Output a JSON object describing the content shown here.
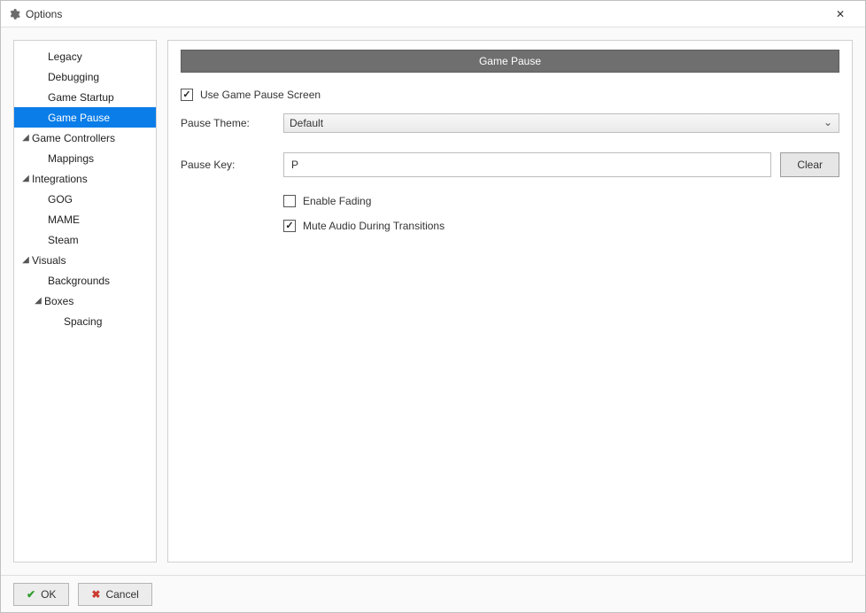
{
  "window": {
    "title": "Options"
  },
  "sidebar": {
    "items": [
      {
        "label": "Legacy",
        "depth": 1,
        "expandable": false
      },
      {
        "label": "Debugging",
        "depth": 1,
        "expandable": false
      },
      {
        "label": "Game Startup",
        "depth": 1,
        "expandable": false
      },
      {
        "label": "Game Pause",
        "depth": 1,
        "expandable": false,
        "selected": true
      },
      {
        "label": "Game Controllers",
        "depth": 0,
        "expandable": true,
        "expanded": true
      },
      {
        "label": "Mappings",
        "depth": 1,
        "expandable": false
      },
      {
        "label": "Integrations",
        "depth": 0,
        "expandable": true,
        "expanded": true
      },
      {
        "label": "GOG",
        "depth": 1,
        "expandable": false
      },
      {
        "label": "MAME",
        "depth": 1,
        "expandable": false
      },
      {
        "label": "Steam",
        "depth": 1,
        "expandable": false
      },
      {
        "label": "Visuals",
        "depth": 0,
        "expandable": true,
        "expanded": true
      },
      {
        "label": "Backgrounds",
        "depth": 1,
        "expandable": false
      },
      {
        "label": "Boxes",
        "depth": 1,
        "expandable": true,
        "expanded": true
      },
      {
        "label": "Spacing",
        "depth": 2,
        "expandable": false
      }
    ]
  },
  "panel": {
    "header": "Game Pause",
    "use_pause_screen": {
      "label": "Use Game Pause Screen",
      "checked": true
    },
    "theme_label": "Pause Theme:",
    "theme_value": "Default",
    "key_label": "Pause Key:",
    "key_value": "P",
    "clear_label": "Clear",
    "enable_fading": {
      "label": "Enable Fading",
      "checked": false
    },
    "mute_audio": {
      "label": "Mute Audio During Transitions",
      "checked": true
    }
  },
  "footer": {
    "ok": "OK",
    "cancel": "Cancel"
  }
}
